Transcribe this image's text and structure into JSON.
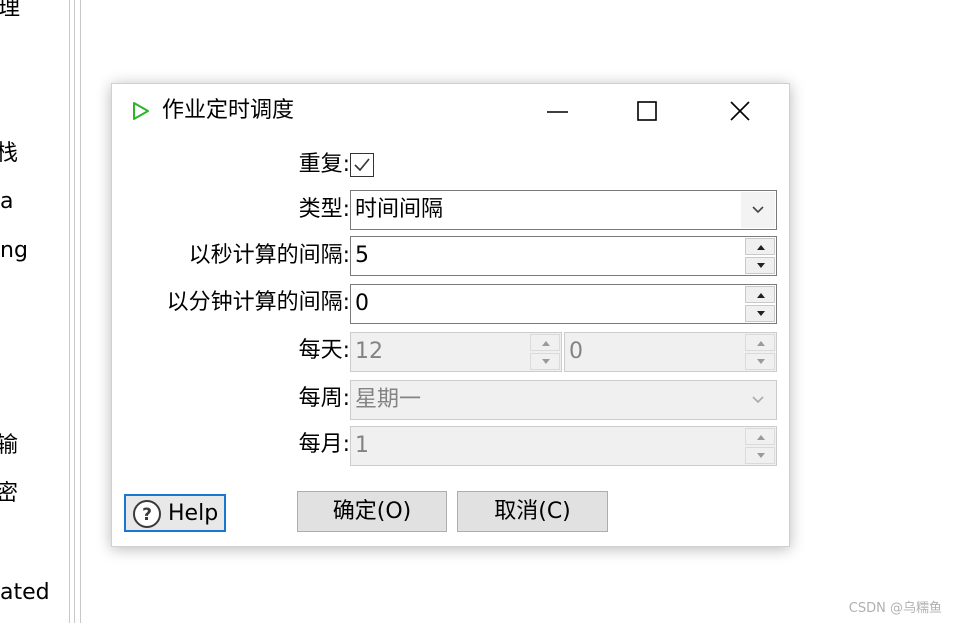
{
  "background": {
    "left_texts": [
      "理",
      "栈",
      "a",
      "ng",
      "输",
      "密",
      "ated"
    ],
    "watermark": "CSDN @乌糯鱼"
  },
  "dialog": {
    "title": "作业定时调度",
    "title_icon": "play-icon",
    "window_buttons": [
      "minimize-icon",
      "maximize-icon",
      "close-icon"
    ],
    "repeat": {
      "label": "重复:",
      "checked": true
    },
    "type": {
      "label": "类型:",
      "value": "时间间隔"
    },
    "interval_seconds": {
      "label": "以秒计算的间隔:",
      "value": "5"
    },
    "interval_minutes": {
      "label": "以分钟计算的间隔:",
      "value": "0"
    },
    "daily": {
      "label": "每天:",
      "hour": "12",
      "minute": "0"
    },
    "weekly": {
      "label": "每周:",
      "value": "星期一"
    },
    "monthly": {
      "label": "每月:",
      "value": "1"
    },
    "buttons": {
      "help": "Help",
      "ok": "确定(O)",
      "cancel": "取消(C)"
    },
    "colors": {
      "accent": "#1976d2",
      "play_icon": "#2bb52b",
      "disabled_text": "#838383"
    }
  }
}
